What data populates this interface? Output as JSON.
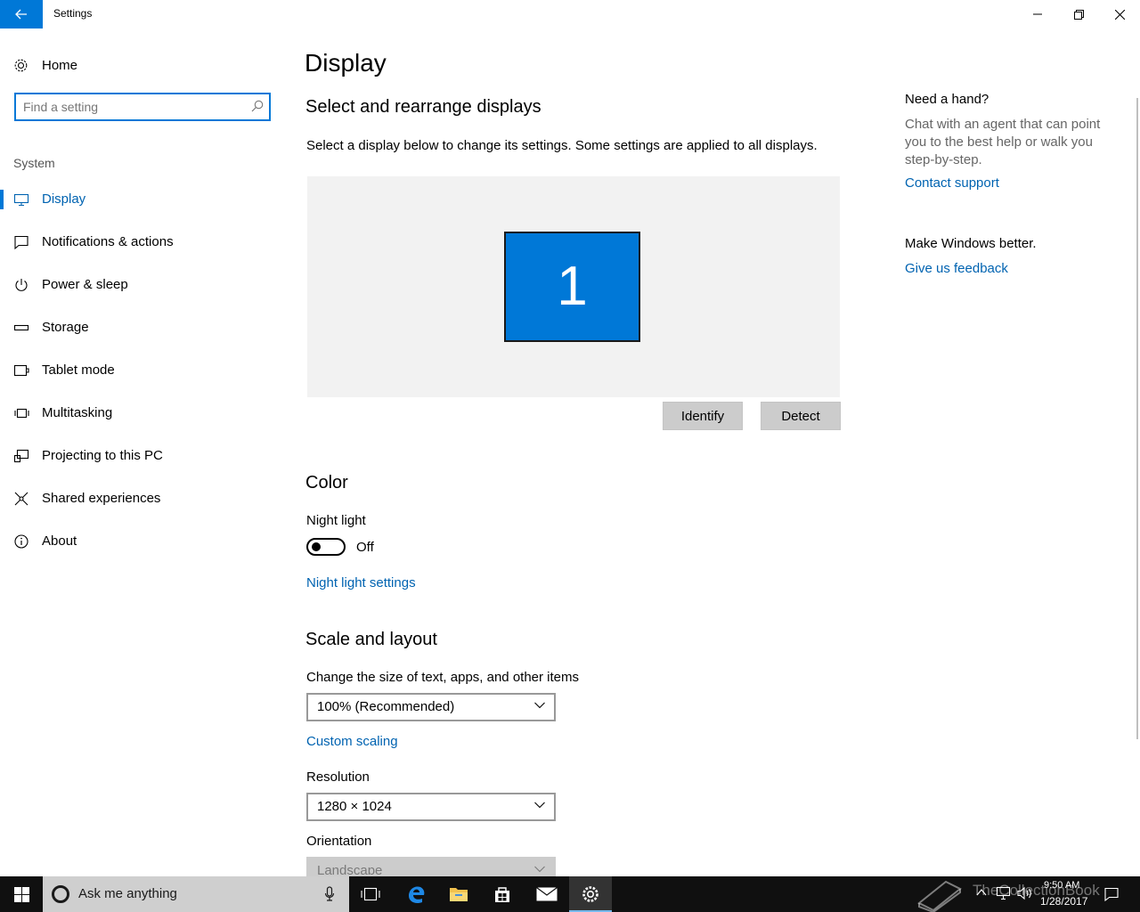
{
  "window": {
    "title": "Settings"
  },
  "sidebar": {
    "home_label": "Home",
    "search_placeholder": "Find a setting",
    "section_label": "System",
    "items": [
      {
        "label": "Display",
        "icon": "monitor-icon",
        "active": true
      },
      {
        "label": "Notifications & actions",
        "icon": "notification-icon"
      },
      {
        "label": "Power & sleep",
        "icon": "power-icon"
      },
      {
        "label": "Storage",
        "icon": "storage-icon"
      },
      {
        "label": "Tablet mode",
        "icon": "tablet-mode-icon"
      },
      {
        "label": "Multitasking",
        "icon": "multitasking-icon"
      },
      {
        "label": "Projecting to this PC",
        "icon": "projecting-icon"
      },
      {
        "label": "Shared experiences",
        "icon": "shared-experiences-icon"
      },
      {
        "label": "About",
        "icon": "info-icon"
      }
    ]
  },
  "main": {
    "title": "Display",
    "select_heading": "Select and rearrange displays",
    "select_desc": "Select a display below to change its settings. Some settings are applied to all displays.",
    "monitor_number": "1",
    "identify_label": "Identify",
    "detect_label": "Detect",
    "color_heading": "Color",
    "night_light_label": "Night light",
    "night_light_state": "Off",
    "night_light_settings_link": "Night light settings",
    "scale_heading": "Scale and layout",
    "scale_desc": "Change the size of text, apps, and other items",
    "scale_value": "100% (Recommended)",
    "custom_scaling_link": "Custom scaling",
    "resolution_label": "Resolution",
    "resolution_value": "1280 × 1024",
    "orientation_label": "Orientation",
    "orientation_value": "Landscape"
  },
  "right_pane": {
    "help_title": "Need a hand?",
    "help_text": "Chat with an agent that can point you to the best help or walk you step-by-step.",
    "contact_link": "Contact support",
    "feedback_title": "Make Windows better.",
    "feedback_link": "Give us feedback"
  },
  "taskbar": {
    "cortana_text": "Ask me anything",
    "time": "9:50 AM",
    "date": "1/28/2017",
    "watermark": "TheCollectionBook"
  },
  "colors": {
    "accent": "#0078d7",
    "link": "#0063b1",
    "taskbar": "#101010"
  }
}
